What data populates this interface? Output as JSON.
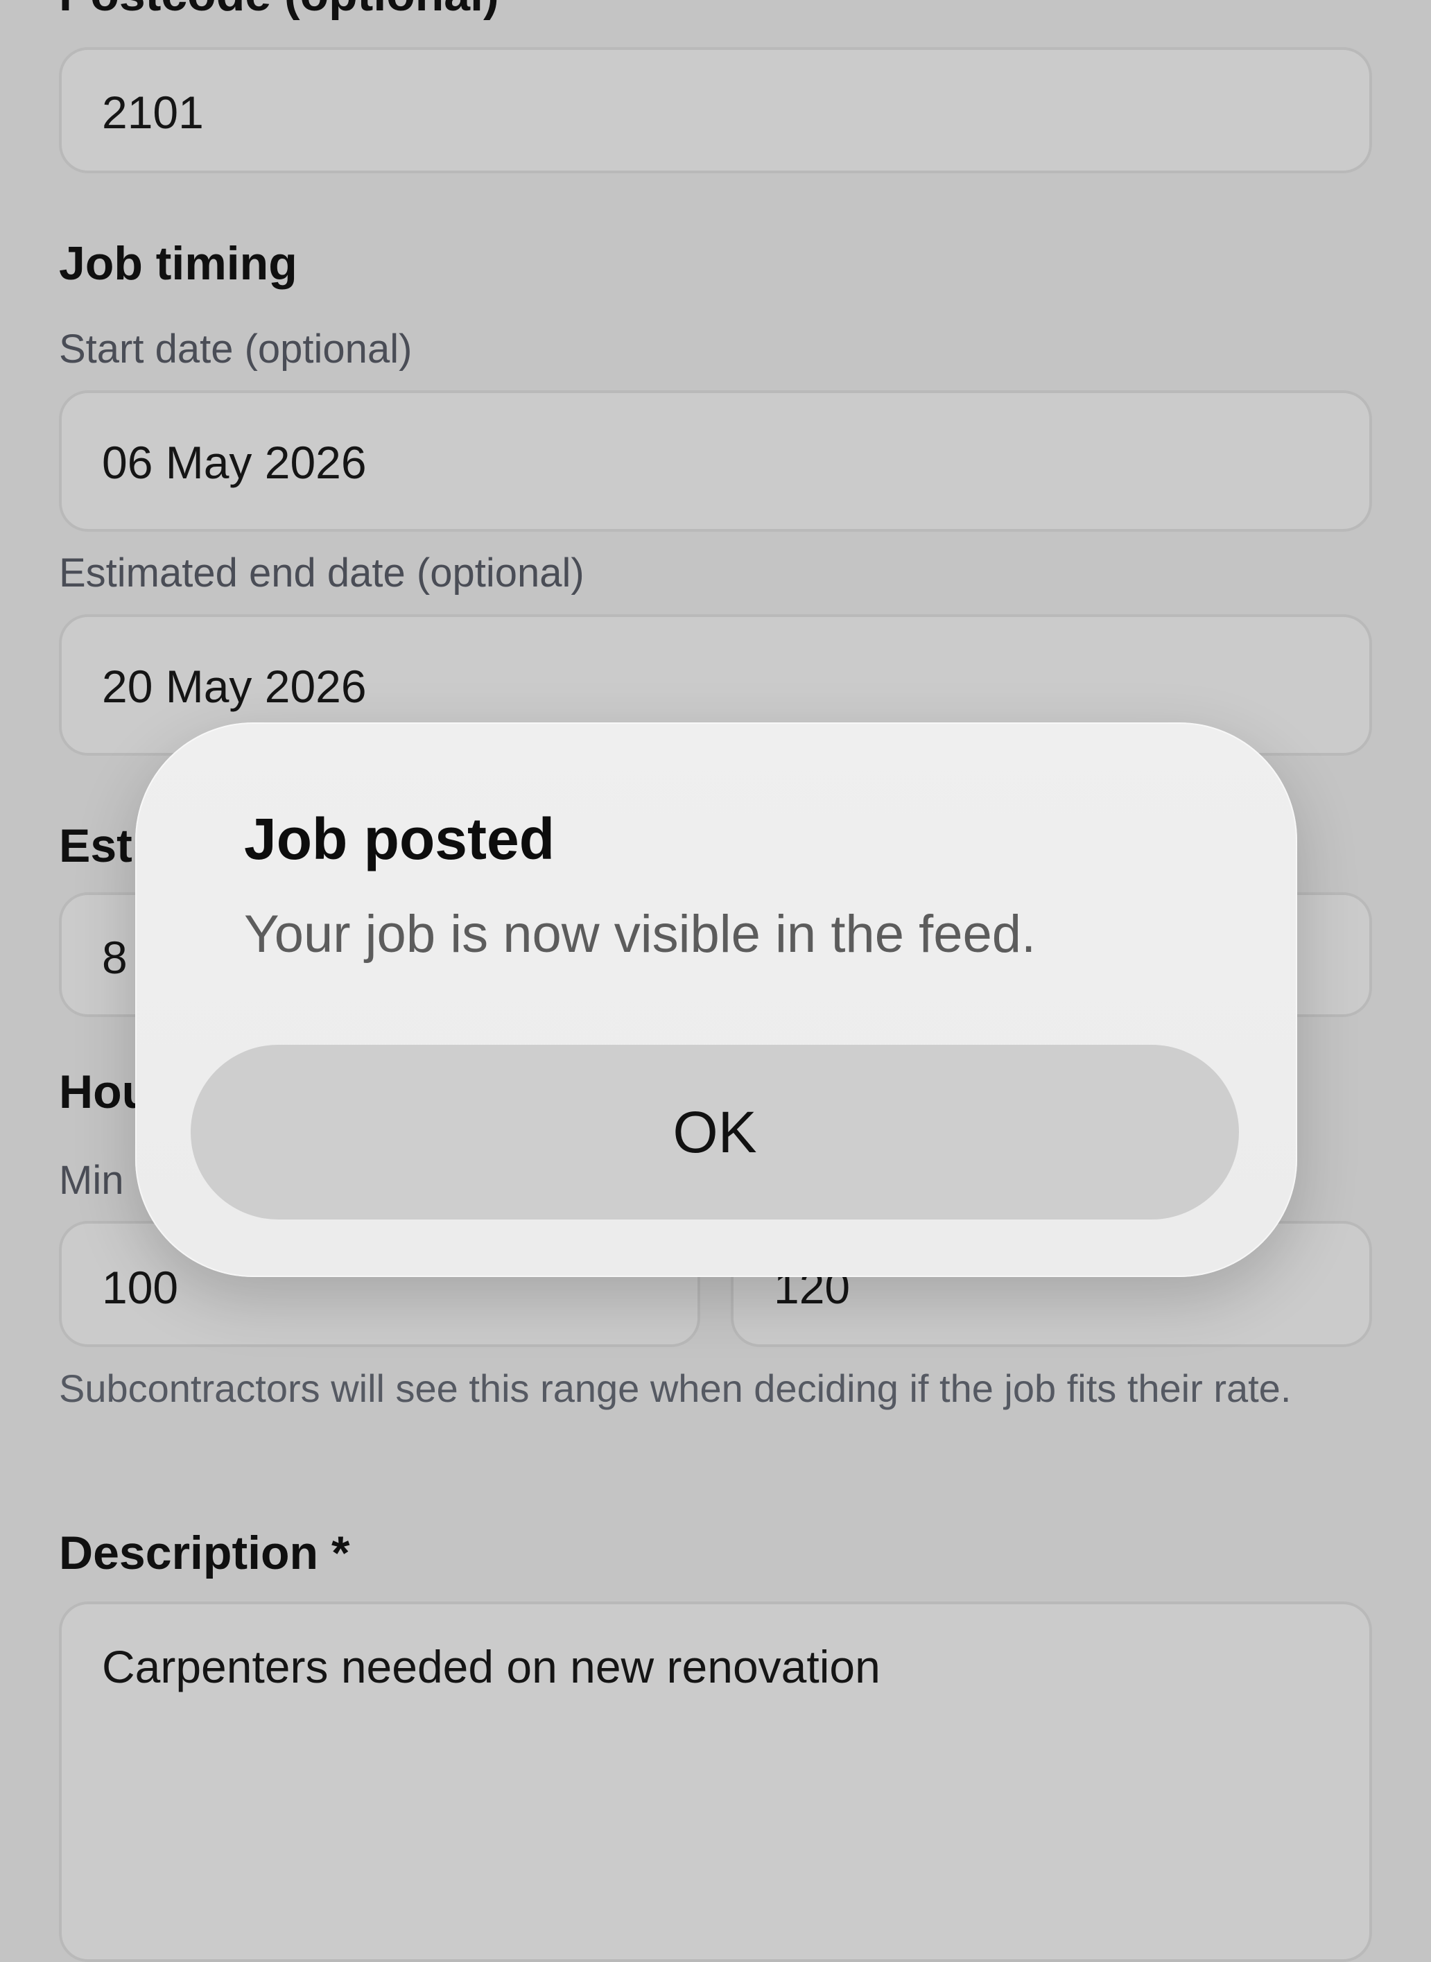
{
  "form": {
    "postcode_label": "Postcode (optional)",
    "postcode_value": "2101",
    "job_timing_heading": "Job timing",
    "start_date_label": "Start date (optional)",
    "start_date_value": "06 May 2026",
    "end_date_label": "Estimated end date (optional)",
    "end_date_value": "20 May 2026",
    "partial_heading_est": "Est",
    "partial_value_8": "8",
    "partial_heading_hou": "Hou",
    "partial_label_min": "Min",
    "min_rate_value": "100",
    "max_rate_value": "120",
    "rate_helper_text": "Subcontractors will see this range when deciding if the job fits their rate.",
    "description_label": "Description *",
    "description_value": "Carpenters needed on new renovation"
  },
  "dialog": {
    "title": "Job posted",
    "message": "Your job is now visible in the feed.",
    "ok_label": "OK"
  }
}
